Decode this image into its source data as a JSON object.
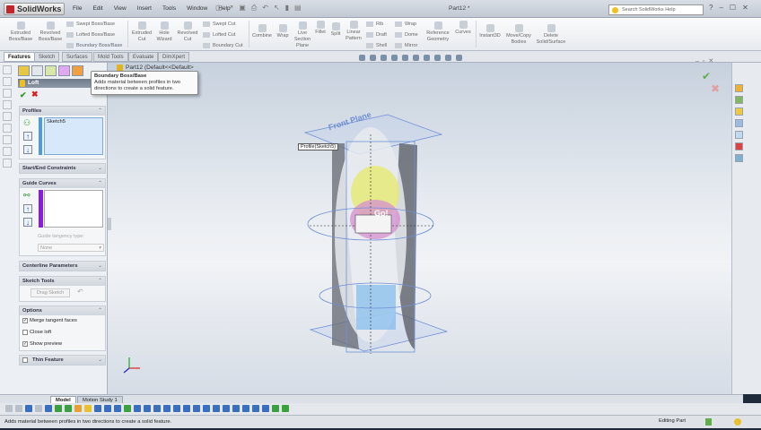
{
  "app": {
    "logo": "SolidWorks",
    "title": "Part12 *"
  },
  "menu": [
    "File",
    "Edit",
    "View",
    "Insert",
    "Tools",
    "Window",
    "Help"
  ],
  "search": {
    "placeholder": "Search SolidWorks Help"
  },
  "ribbon": {
    "extruded_boss": "Extruded Boss/Base",
    "revolved_boss": "Revolved Boss/Base",
    "swept_boss": "Swept Boss/Base",
    "lofted_boss": "Lofted Boss/Base",
    "boundary_boss": "Boundary Boss/Base",
    "extruded_cut": "Extruded Cut",
    "hole_wizard": "Hole Wizard",
    "revolved_cut": "Revolved Cut",
    "swept_cut": "Swept Cut",
    "lofted_cut": "Lofted Cut",
    "boundary_cut": "Boundary Cut",
    "combine": "Combine",
    "wrap": "Wrap",
    "live_section": "Live Section Plane",
    "fillet": "Fillet",
    "split": "Split",
    "linear_pattern": "Linear Pattern",
    "rib": "Rib",
    "draft": "Draft",
    "shell": "Shell",
    "wrap2": "Wrap",
    "dome": "Dome",
    "mirror": "Mirror",
    "reference_geometry": "Reference Geometry",
    "curves": "Curves",
    "instant3d": "Instant3D",
    "move_copy": "Move/Copy Bodies",
    "delete_solid": "Delete Solid/Surface"
  },
  "tabs": [
    "Features",
    "Sketch",
    "Surfaces",
    "Mold Tools",
    "Evaluate",
    "DimXpert"
  ],
  "tree_root": "Part12  (Default<<Default>",
  "tooltip": {
    "title": "Boundary Boss/Base",
    "body": "Adds material between profiles in two directions to create a solid feature."
  },
  "property_manager": {
    "title": "Loft",
    "profiles": {
      "header": "Profiles",
      "items": [
        "Sketch5"
      ]
    },
    "start_end": "Start/End Constraints",
    "guide_curves": {
      "header": "Guide Curves",
      "tangency_label": "Guide tangency type:",
      "tangency_value": "None"
    },
    "centerline": "Centerline Parameters",
    "sketch_tools": {
      "header": "Sketch Tools",
      "drag": "Drag Sketch"
    },
    "options": {
      "header": "Options",
      "merge": "Merge tangent faces",
      "close": "Close loft",
      "preview": "Show preview",
      "merge_checked": true,
      "close_checked": false,
      "preview_checked": true
    },
    "thin": "Thin Feature"
  },
  "viewport": {
    "callout": "Profile(Sketch5)",
    "plane_label": "Front Plane",
    "label_go": "Go!"
  },
  "bottom_tabs": [
    "Model",
    "Motion Study 1"
  ],
  "status": {
    "message": "Adds material between profiles in two directions to create a solid feature.",
    "mode": "Editing Part"
  },
  "colors": {
    "accent": "#c0262b",
    "purple": "#8a1be0",
    "profile_blue": "#4a9be8"
  }
}
